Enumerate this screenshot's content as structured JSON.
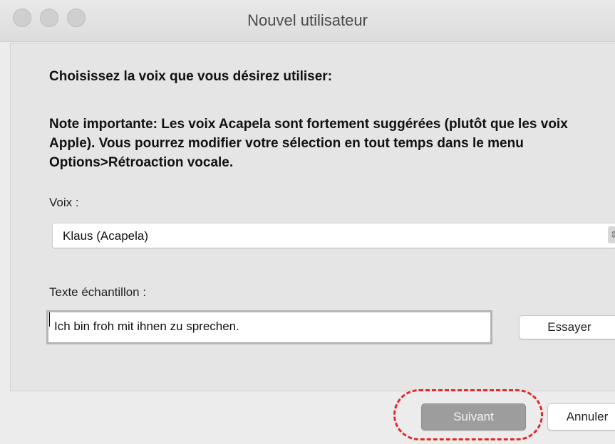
{
  "window": {
    "title": "Nouvel utilisateur"
  },
  "content": {
    "heading": "Choisissez la voix que vous désirez utiliser:",
    "note": "Note importante: Les voix Acapela sont fortement suggérées (plutôt que les voix Apple).  Vous pourrez modifier votre sélection en tout temps dans le menu Options>Rétroaction vocale.",
    "voice_label": "Voix :",
    "voice_value": "Klaus (Acapela)",
    "sample_label": "Texte échantillon :",
    "sample_value": "Ich bin froh mit ihnen zu sprechen.",
    "try_button": "Essayer"
  },
  "footer": {
    "next_button": "Suivant",
    "cancel_button": "Annuler"
  },
  "colors": {
    "highlight": "#e02a2a",
    "next_button_bg": "#9d9d9d"
  },
  "icons": {
    "stepper": "updown-chevron-icon"
  }
}
